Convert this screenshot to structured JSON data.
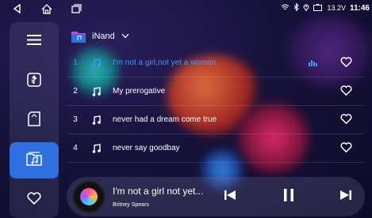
{
  "status": {
    "time": "11:46",
    "voltage": "13.2V",
    "icons": [
      "wifi-icon",
      "bluetooth-icon",
      "location-icon",
      "battery-icon"
    ]
  },
  "nav": {
    "icons": [
      "back-icon",
      "home-icon",
      "recent-apps-icon"
    ]
  },
  "sidebar": {
    "items": [
      {
        "name": "menu",
        "icon": "list-icon"
      },
      {
        "name": "usb",
        "icon": "usb-icon"
      },
      {
        "name": "sd-card",
        "icon": "sd-card-icon"
      },
      {
        "name": "music-folder",
        "icon": "music-folder-icon",
        "active": true
      },
      {
        "name": "favorites",
        "icon": "heart-icon"
      }
    ]
  },
  "source": {
    "label": "iNand"
  },
  "tracks": [
    {
      "num": "1",
      "title": "I'm not a girl,not yet a woman",
      "playing": true
    },
    {
      "num": "2",
      "title": "My prerogative",
      "playing": false
    },
    {
      "num": "3",
      "title": "never had a dream come true",
      "playing": false
    },
    {
      "num": "4",
      "title": "never say goodbay",
      "playing": false
    }
  ],
  "now_playing": {
    "title": "I'm not a girl not yet...",
    "artist": "Britney Spears"
  },
  "colors": {
    "accent": "#2f6fe0",
    "playing_text": "#3a9bff"
  }
}
